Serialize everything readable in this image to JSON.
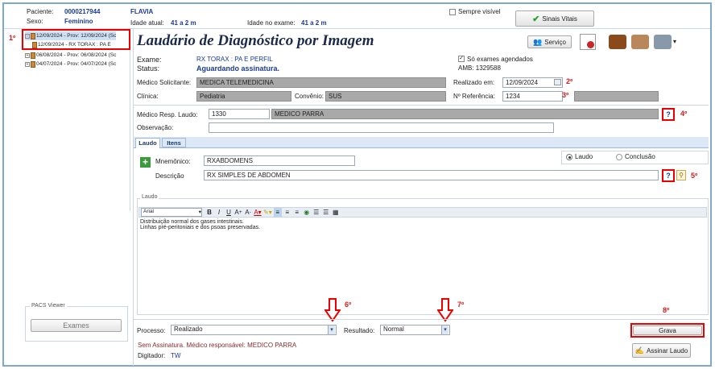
{
  "patient": {
    "id_label": "Paciente:",
    "id": "0000217944",
    "name": "FLAVIA",
    "sex_label": "Sexo:",
    "sex": "Feminino",
    "age_label": "Idade atual:",
    "age": "41 a 2 m",
    "age_exam_label": "Idade no exame:",
    "age_exam": "41 a 2 m",
    "always_visible": "Sempre visível",
    "vitals_button": "Sinais Vitais"
  },
  "tree": {
    "items": [
      {
        "label": "12/09/2024 - Prov: 12/09/2024 (Sc",
        "selected": true
      },
      {
        "label": "12/09/2024 - RX TORAX : PA E",
        "child": true
      },
      {
        "label": "06/08/2024 - Prov: 06/08/2024 (Sc"
      },
      {
        "label": "04/07/2024 - Prov: 04/07/2024 (Sc"
      }
    ]
  },
  "pacs": {
    "label": "PACS Viewer",
    "button": "Exames"
  },
  "header": {
    "title": "Laudário de Diagnóstico por Imagem",
    "servico": "Serviço"
  },
  "exam": {
    "exam_label": "Exame:",
    "exam": "RX TORAX : PA E PERFIL",
    "status_label": "Status:",
    "status": "Aguardando assinatura.",
    "only_scheduled": "Só exames agendados",
    "amb": "AMB: 1329588",
    "medico_label": "Médico Solicitante:",
    "medico": "MEDICA  TELEMEDICINA",
    "realizado_label": "Realizado em:",
    "realizado": "12/09/2024",
    "clinica_label": "Clínica:",
    "clinica": "Pediatria",
    "convenio_label": "Convênio:",
    "convenio": "SUS",
    "ref_label": "Nº Referência:",
    "ref": "1234",
    "resp_label": "Médico Resp. Laudo:",
    "resp_code": "1330",
    "resp_name": "MEDICO PARRA",
    "obs_label": "Observação:",
    "obs": ""
  },
  "tabs": [
    "Laudo",
    "Itens"
  ],
  "laudo": {
    "mnemonico_label": "Mnemônico:",
    "mnemonico": "RXABDOMENS",
    "descricao_label": "Descrição",
    "descricao": "RX SIMPLES DE ABDOMEN",
    "radio_laudo": "Laudo",
    "radio_conclusao": "Conclusão",
    "section_label": "Laudo",
    "font": "Arial",
    "text_line1": "Distribuição normal dos gases intestinais.",
    "text_line2": "Linhas pré-peritoniais e dos psoas preservadas."
  },
  "footer": {
    "processo_label": "Processo:",
    "processo": "Realizado",
    "resultado_label": "Resultado:",
    "resultado": "Normal",
    "grava": "Grava",
    "status": "Sem Assinatura. Médico responsável: MEDICO PARRA",
    "digitador_label": "Digitador:",
    "digitador": "TW",
    "assinar": "Assinar Laudo"
  },
  "annotations": {
    "a1": "1º",
    "a2": "2º",
    "a3": "3º",
    "a4": "4º",
    "a5": "5º",
    "a6": "6º",
    "a7": "7º",
    "a8": "8º"
  },
  "colors": {
    "title": "#1b2a4a",
    "accent": "#1a3a9a",
    "red": "#d81b1b",
    "frame": "#7fa8cf"
  }
}
